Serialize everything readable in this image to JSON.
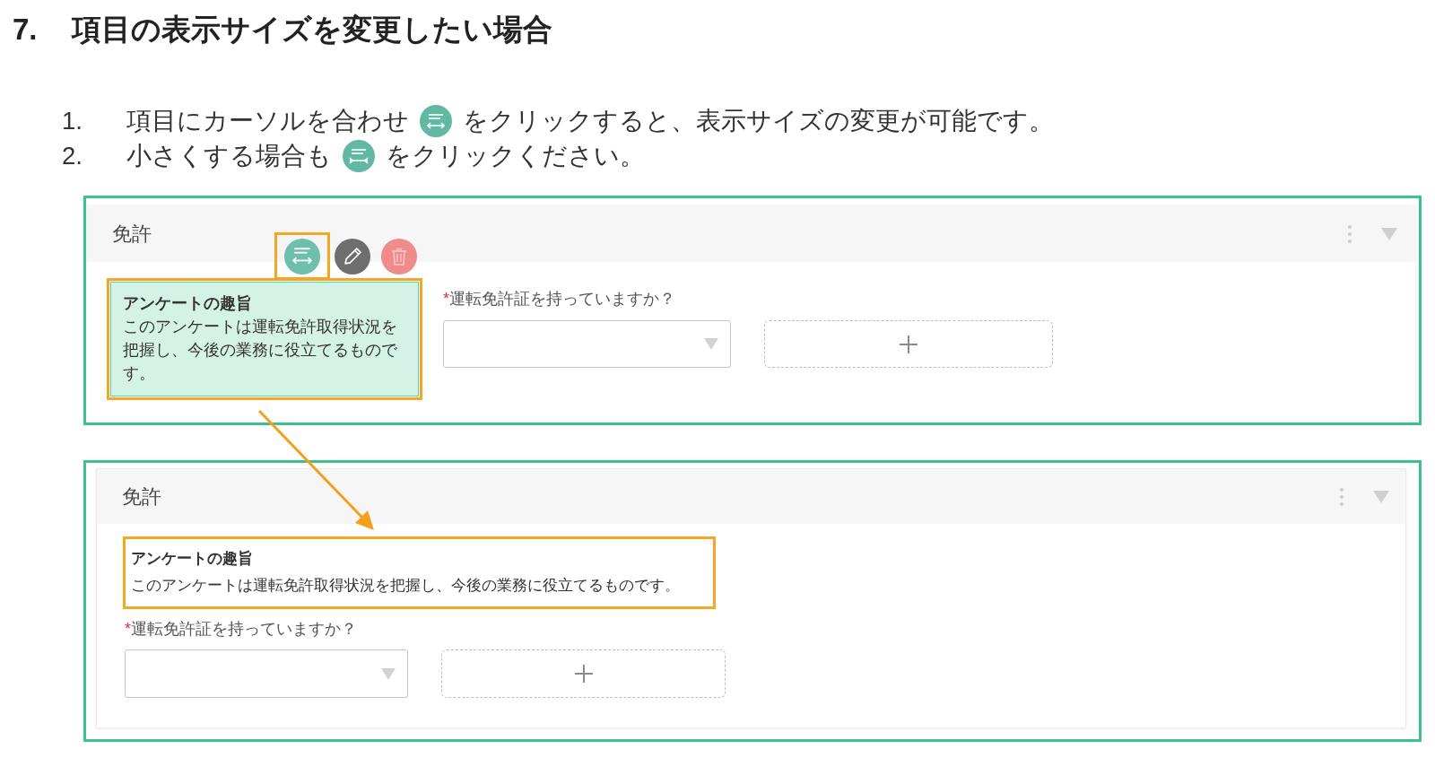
{
  "heading": {
    "number": "7.",
    "text": "項目の表示サイズを変更したい場合"
  },
  "steps": [
    {
      "number": "1.",
      "parts": [
        {
          "kind": "text",
          "text": "項目にカーソルを合わせ"
        },
        {
          "kind": "widen"
        },
        {
          "kind": "text",
          "text": "をクリックすると、表示サイズの変更が可能です。"
        }
      ]
    },
    {
      "number": "2.",
      "parts": [
        {
          "kind": "text",
          "text": "小さくする場合も"
        },
        {
          "kind": "narrow"
        },
        {
          "kind": "text",
          "text": "をクリックください。"
        }
      ]
    }
  ],
  "panels": [
    {
      "kind": "side",
      "highlighted": true,
      "title": "免許",
      "toolbar": [
        {
          "kind": "resize",
          "highlighted": true
        },
        {
          "kind": "edit",
          "highlighted": false
        },
        {
          "kind": "delete",
          "highlighted": false
        }
      ],
      "description": {
        "title": "アンケートの趣旨",
        "text": "このアンケートは運転免許取得状況を把握し、今後の業務に役立てるものです。",
        "selected": true,
        "highlighted": true
      },
      "question": {
        "required_mark": "*",
        "label": "運転免許証を持っていますか？"
      }
    },
    {
      "kind": "stacked",
      "highlighted": true,
      "title": "免許",
      "description": {
        "title": "アンケートの趣旨",
        "text": "このアンケートは運転免許取得状況を把握し、今後の業務に役立てるものです。",
        "selected": false,
        "highlighted": true
      },
      "question": {
        "required_mark": "*",
        "label": "運転免許証を持っていますか？"
      }
    }
  ]
}
